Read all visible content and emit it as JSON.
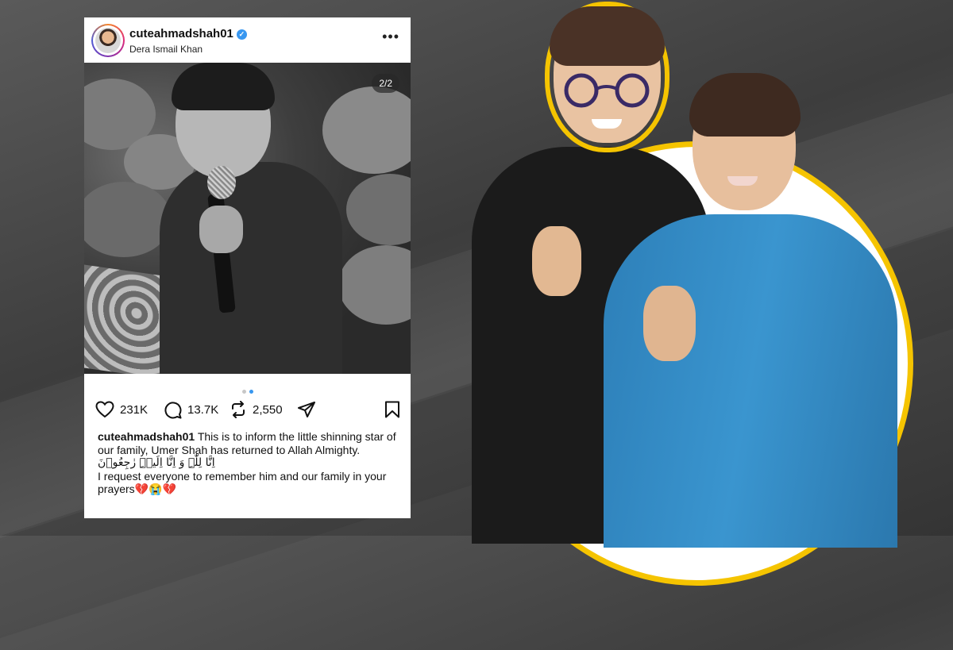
{
  "post": {
    "username": "cuteahmadshah01",
    "location": "Dera Ismail Khan",
    "image_counter": "2/2",
    "likes": "231K",
    "comments": "13.7K",
    "reposts": "2,550",
    "caption_user": "cuteahmadshah01",
    "caption_text": "This is to inform the little shinning star of our family, Umer Shah has returned to Allah Almighty.",
    "caption_arabic": "اِنَّا لِلّٰہِ وَ اِنَّا اِلَیۡہِ رٰجِعُوۡنَ",
    "caption_request": "I request everyone to remember him and our family in your prayers💔😭💔"
  },
  "colors": {
    "accent_frame": "#f5c400",
    "verified": "#3897f0",
    "active_dot": "#3897f0"
  },
  "icons": [
    "verified-icon",
    "more-icon",
    "heart-icon",
    "comment-icon",
    "repost-icon",
    "share-icon",
    "bookmark-icon"
  ]
}
